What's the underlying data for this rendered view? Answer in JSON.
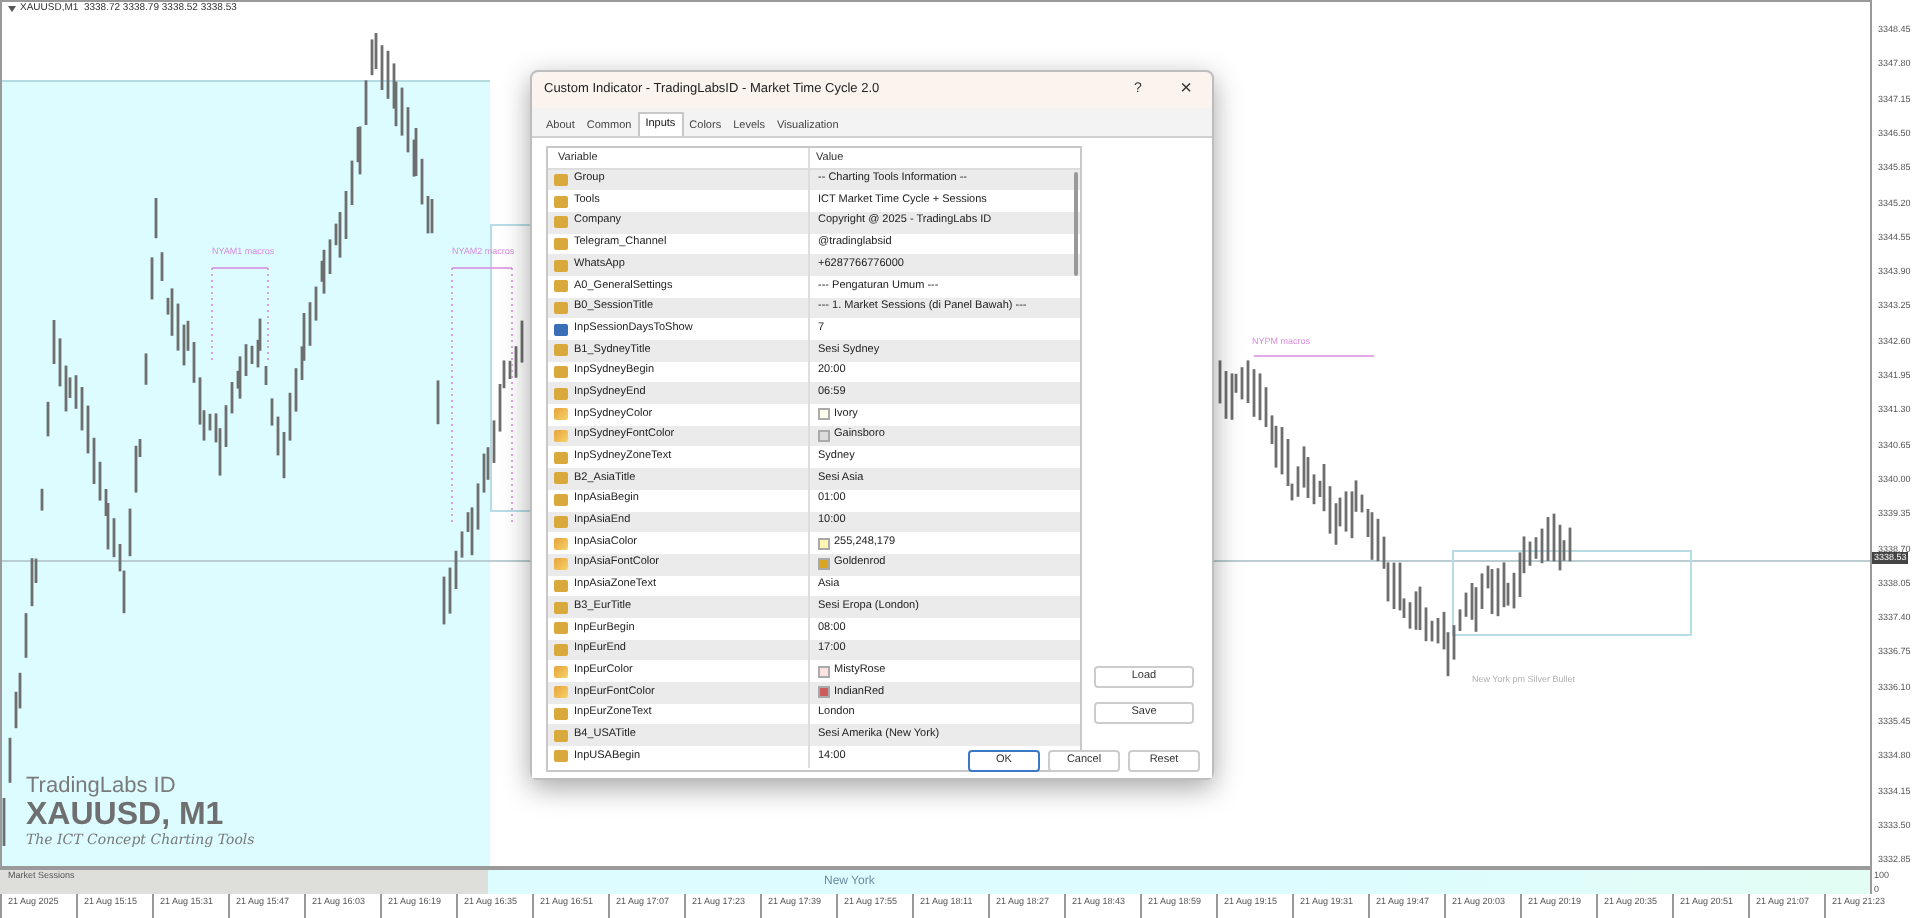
{
  "chart": {
    "header": "XAUUSD,M1  3338.72 3338.79 3338.52 3338.53",
    "price_axis": [
      "3348.45",
      "3347.80",
      "3347.15",
      "3346.50",
      "3345.85",
      "3345.20",
      "3344.55",
      "3343.90",
      "3343.25",
      "3342.60",
      "3341.95",
      "3341.30",
      "3340.65",
      "3340.00",
      "3339.35",
      "3338.70",
      "3338.05",
      "3337.40",
      "3336.75",
      "3336.10",
      "3335.45",
      "3334.80",
      "3334.15",
      "3333.50",
      "3332.85"
    ],
    "current_price": "3338.53",
    "labels": [
      {
        "kind": "macro",
        "text": "NYAM1 macros"
      },
      {
        "kind": "macro",
        "text": "NYAM2 macros"
      },
      {
        "kind": "macro",
        "text": "NYPM macros"
      },
      {
        "kind": "zone",
        "text": "New York pm Silver Bullet"
      }
    ],
    "branding": {
      "company": "TradingLabs ID",
      "symbol": "XAUUSD, M1",
      "tagline": "The ICT Concept Charting Tools"
    },
    "indicator_pane": {
      "title": "Market Sessions",
      "session": "New York",
      "scale": [
        "100",
        "0"
      ]
    },
    "time_axis": [
      "21 Aug 2025",
      "21 Aug 15:15",
      "21 Aug 15:31",
      "21 Aug 15:47",
      "21 Aug 16:03",
      "21 Aug 16:19",
      "21 Aug 16:35",
      "21 Aug 16:51",
      "21 Aug 17:07",
      "21 Aug 17:23",
      "21 Aug 17:39",
      "21 Aug 17:55",
      "21 Aug 18:11",
      "21 Aug 18:27",
      "21 Aug 18:43",
      "21 Aug 18:59",
      "21 Aug 19:15",
      "21 Aug 19:31",
      "21 Aug 19:47",
      "21 Aug 20:03",
      "21 Aug 20:19",
      "21 Aug 20:35",
      "21 Aug 20:51",
      "21 Aug 21:07",
      "21 Aug 21:23"
    ]
  },
  "dialog": {
    "title": "Custom Indicator - TradingLabsID - Market Time Cycle 2.0",
    "help": "?",
    "close": "×",
    "tabs": [
      {
        "label": "About",
        "selected": false
      },
      {
        "label": "Common",
        "selected": false
      },
      {
        "label": "Inputs",
        "selected": true
      },
      {
        "label": "Colors",
        "selected": false
      },
      {
        "label": "Levels",
        "selected": false
      },
      {
        "label": "Visualization",
        "selected": false
      }
    ],
    "columns": [
      "Variable",
      "Value"
    ],
    "rows": [
      {
        "kind": "text",
        "variable": "Group",
        "value": "-- Charting Tools Information --"
      },
      {
        "kind": "text",
        "variable": "Tools",
        "value": "ICT Market Time Cycle + Sessions"
      },
      {
        "kind": "text",
        "variable": "Company",
        "value": "Copyright @ 2025 - TradingLabs ID"
      },
      {
        "kind": "text",
        "variable": "Telegram_Channel",
        "value": "@tradinglabsid"
      },
      {
        "kind": "text",
        "variable": "WhatsApp",
        "value": "+6287766776000"
      },
      {
        "kind": "text",
        "variable": "A0_GeneralSettings",
        "value": "--- Pengaturan Umum ---"
      },
      {
        "kind": "text",
        "variable": "B0_SessionTitle",
        "value": "--- 1. Market Sessions (di Panel Bawah) ---"
      },
      {
        "kind": "number",
        "variable": "InpSessionDaysToShow",
        "value": "7"
      },
      {
        "kind": "text",
        "variable": "B1_SydneyTitle",
        "value": "Sesi Sydney"
      },
      {
        "kind": "text",
        "variable": "InpSydneyBegin",
        "value": "20:00"
      },
      {
        "kind": "text",
        "variable": "InpSydneyEnd",
        "value": "06:59"
      },
      {
        "kind": "color",
        "variable": "InpSydneyColor",
        "value": "Ivory",
        "color": "#fffff0"
      },
      {
        "kind": "color",
        "variable": "InpSydneyFontColor",
        "value": "Gainsboro",
        "color": "#dcdcdc"
      },
      {
        "kind": "text",
        "variable": "InpSydneyZoneText",
        "value": "Sydney"
      },
      {
        "kind": "text",
        "variable": "B2_AsiaTitle",
        "value": "Sesi Asia"
      },
      {
        "kind": "text",
        "variable": "InpAsiaBegin",
        "value": "01:00"
      },
      {
        "kind": "text",
        "variable": "InpAsiaEnd",
        "value": "10:00"
      },
      {
        "kind": "color",
        "variable": "InpAsiaColor",
        "value": "255,248,179",
        "color": "#fff8b3"
      },
      {
        "kind": "color",
        "variable": "InpAsiaFontColor",
        "value": "Goldenrod",
        "color": "#daa520"
      },
      {
        "kind": "text",
        "variable": "InpAsiaZoneText",
        "value": "Asia"
      },
      {
        "kind": "text",
        "variable": "B3_EurTitle",
        "value": "Sesi Eropa (London)"
      },
      {
        "kind": "text",
        "variable": "InpEurBegin",
        "value": "08:00"
      },
      {
        "kind": "text",
        "variable": "InpEurEnd",
        "value": "17:00"
      },
      {
        "kind": "color",
        "variable": "InpEurColor",
        "value": "MistyRose",
        "color": "#ffe4e1"
      },
      {
        "kind": "color",
        "variable": "InpEurFontColor",
        "value": "IndianRed",
        "color": "#cd5c5c"
      },
      {
        "kind": "text",
        "variable": "InpEurZoneText",
        "value": "London"
      },
      {
        "kind": "text",
        "variable": "B4_USATitle",
        "value": "Sesi Amerika (New York)"
      },
      {
        "kind": "text",
        "variable": "InpUSABegin",
        "value": "14:00"
      }
    ],
    "side_buttons": [
      "Load",
      "Save"
    ],
    "buttons": [
      {
        "label": "OK",
        "kind": "default"
      },
      {
        "label": "Cancel",
        "kind": "normal"
      },
      {
        "label": "Reset",
        "kind": "normal"
      }
    ]
  }
}
